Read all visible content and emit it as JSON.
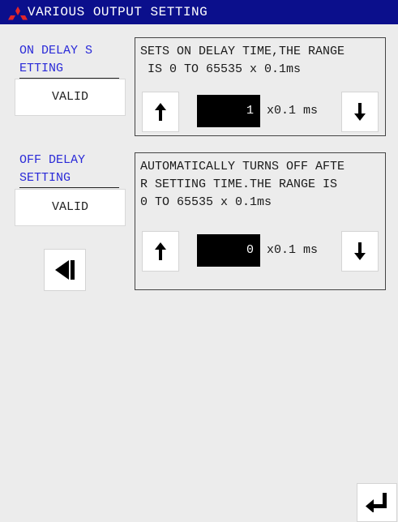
{
  "header": {
    "title": "VARIOUS OUTPUT SETTING",
    "logo_icon": "mitsubishi-logo-icon",
    "title_bg": "#0b0f8c"
  },
  "on_delay": {
    "label_line1": "ON DELAY S",
    "label_line2": "ETTING",
    "value": "VALID",
    "description_line1": "SETS ON DELAY TIME,THE RANGE",
    "description_line2": " IS 0 TO 65535 x 0.1ms",
    "setting": "1",
    "unit": "x0.1 ms",
    "up_icon": "arrow-up-icon",
    "down_icon": "arrow-down-icon"
  },
  "off_delay": {
    "label_line1": "OFF DELAY",
    "label_line2": "SETTING",
    "value": "VALID",
    "description_line1": "AUTOMATICALLY TURNS OFF AFTE",
    "description_line2": "R SETTING TIME.THE RANGE IS",
    "description_line3": "0 TO 65535 x 0.1ms",
    "setting": "0",
    "unit": "x0.1 ms",
    "up_icon": "arrow-up-icon",
    "down_icon": "arrow-down-icon"
  },
  "nav": {
    "back_icon": "triangle-left-bar-icon",
    "enter_icon": "return-arrow-icon"
  },
  "colors": {
    "label_blue": "#2a2ad8",
    "logo_red": "#e4262a"
  }
}
